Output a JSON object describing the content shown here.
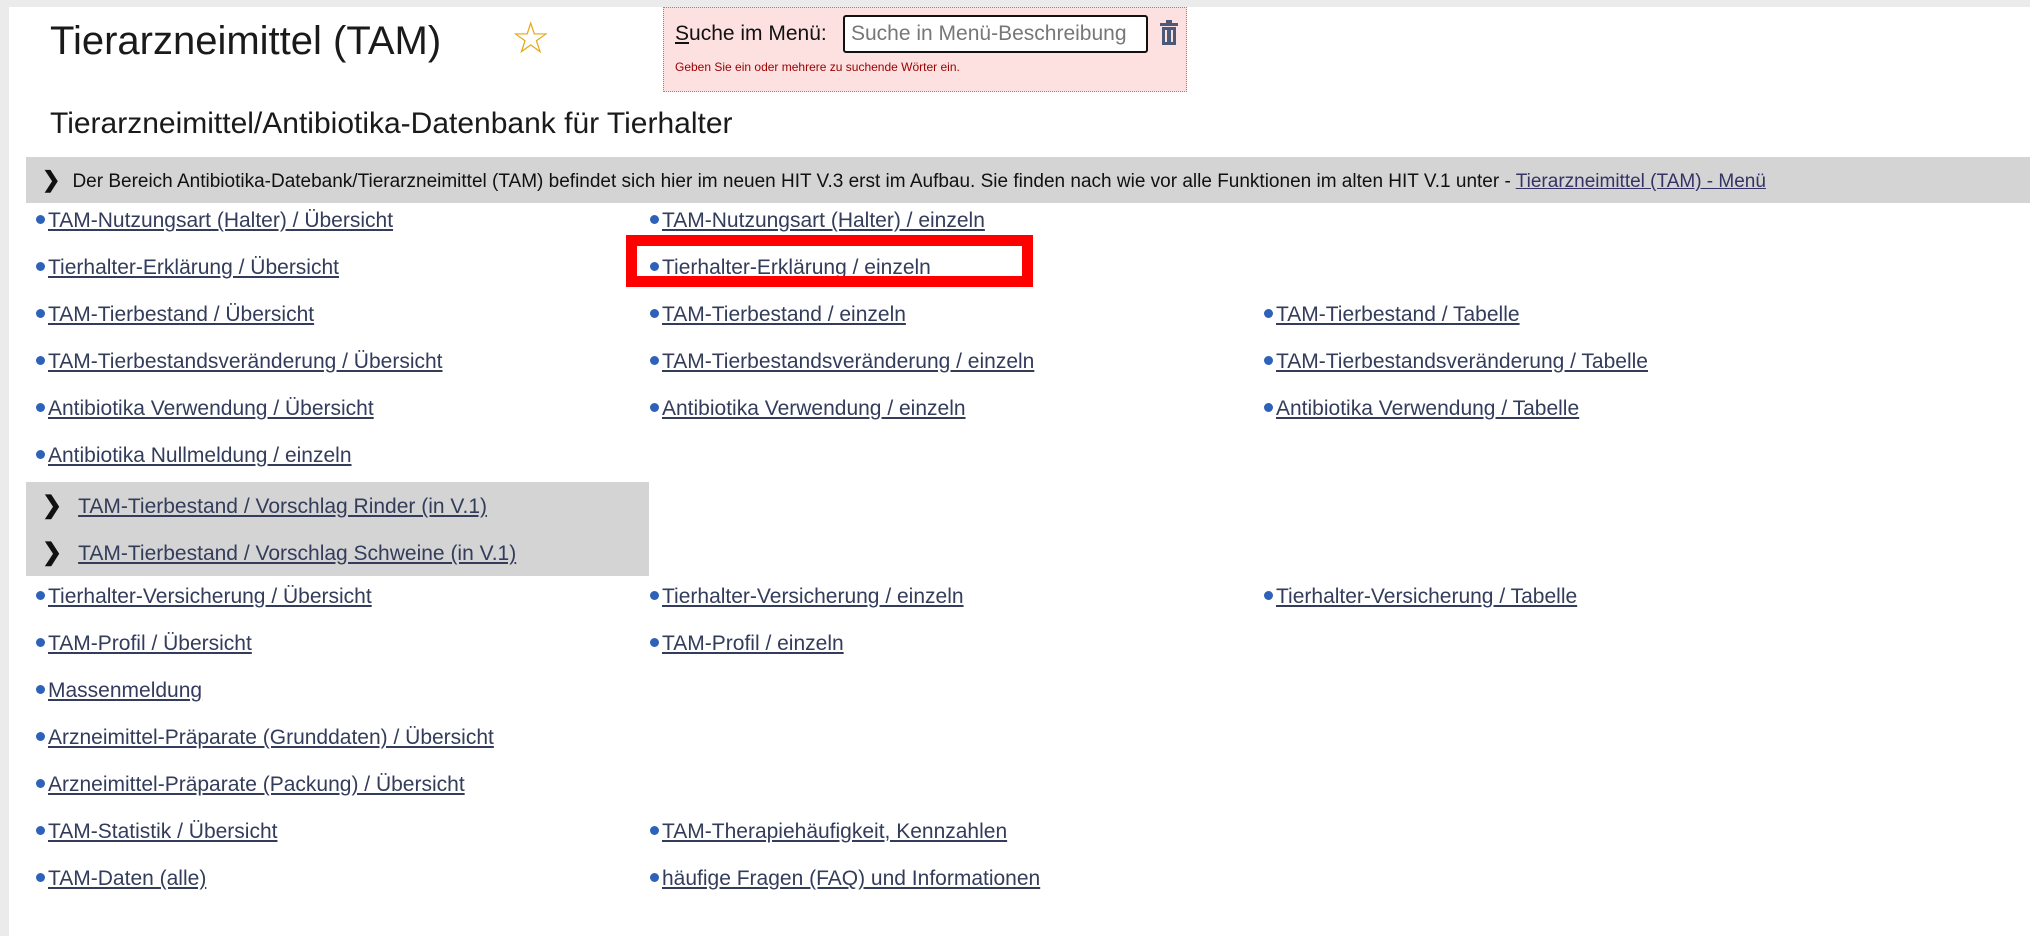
{
  "header": {
    "title": "Tierarzneimittel (TAM)",
    "star": "☆",
    "subtitle": "Tierarzneimittel/Antibiotika-Datenbank für Tierhalter"
  },
  "search": {
    "label_accesskey": "S",
    "label_rest": "uche im Menü:",
    "placeholder": "Suche in Menü-Beschreibung",
    "hint": "Geben Sie ein oder mehrere zu suchende Wörter ein.",
    "clear_icon": "trash-icon"
  },
  "notice": {
    "text": "Der Bereich Antibiotika-Datebank/Tierarzneimittel (TAM) befindet sich hier im neuen HIT V.3 erst im Aufbau. Sie finden nach wie vor alle Funktionen im alten HIT V.1 unter - ",
    "link": "Tierarzneimittel (TAM) - Menü"
  },
  "links": {
    "r1c1": "TAM-Nutzungsart (Halter) / Übersicht",
    "r1c2": "TAM-Nutzungsart (Halter) / einzeln",
    "r2c1": "Tierhalter-Erklärung / Übersicht",
    "r2c2": "Tierhalter-Erklärung / einzeln",
    "r3c1": "TAM-Tierbestand / Übersicht",
    "r3c2": "TAM-Tierbestand / einzeln",
    "r3c3": "TAM-Tierbestand / Tabelle",
    "r4c1": "TAM-Tierbestandsveränderung / Übersicht",
    "r4c2": "TAM-Tierbestandsveränderung / einzeln",
    "r4c3": "TAM-Tierbestandsveränderung / Tabelle",
    "r5c1": "Antibiotika Verwendung / Übersicht",
    "r5c2": "Antibiotika Verwendung / einzeln",
    "r5c3": "Antibiotika Verwendung / Tabelle",
    "r6c1": "Antibiotika Nullmeldung / einzeln",
    "g1": "TAM-Tierbestand / Vorschlag Rinder (in V.1)",
    "g2": "TAM-Tierbestand / Vorschlag Schweine (in V.1)",
    "r9c1": "Tierhalter-Versicherung / Übersicht",
    "r9c2": "Tierhalter-Versicherung / einzeln",
    "r9c3": "Tierhalter-Versicherung / Tabelle",
    "r10c1": "TAM-Profil / Übersicht",
    "r10c2": "TAM-Profil / einzeln",
    "r11c1": "Massenmeldung",
    "r12c1": "Arzneimittel-Präparate (Grunddaten) / Übersicht",
    "r13c1": "Arzneimittel-Präparate (Packung) / Übersicht",
    "r14c1": "TAM-Statistik / Übersicht",
    "r14c2": "TAM-Therapiehäufigkeit, Kennzahlen",
    "r15c1": "TAM-Daten (alle)",
    "r15c2": "häufige Fragen (FAQ) und Informationen"
  },
  "colors": {
    "bullet": "#2e62b8",
    "highlight": "#ff0000",
    "search_bg": "#fde0e0",
    "star": "#e6a817"
  }
}
